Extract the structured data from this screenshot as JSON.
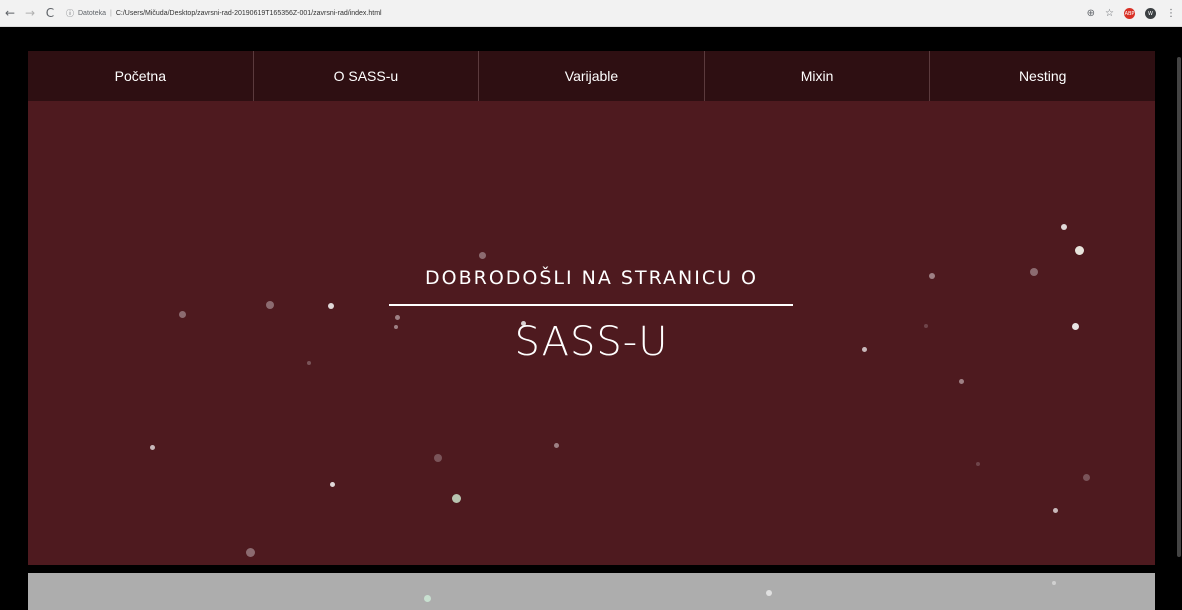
{
  "browser": {
    "back_icon": "←",
    "forward_icon": "→",
    "reload_icon": "C",
    "info_icon": "ⓘ",
    "scheme_label": "Datoteka",
    "url": "C:/Users/Mičuda/Desktop/zavrsni-rad-20190619T165356Z-001/zavrsni-rad/index.html",
    "zoom_icon": "⊕",
    "star_icon": "☆",
    "menu_icon": "⋮",
    "ext_red_label": "ABP",
    "ext_dark_label": "W"
  },
  "nav": {
    "items": [
      {
        "label": "Početna"
      },
      {
        "label": "O SASS-u"
      },
      {
        "label": "Varijable"
      },
      {
        "label": "Mixin"
      },
      {
        "label": "Nesting"
      }
    ]
  },
  "hero": {
    "subtitle": "DOBRODOŠLI NA STRANICU O",
    "title": "SASS-U"
  },
  "colors": {
    "nav_bg": "#2e0f12",
    "hero_bg": "#4e1a1f",
    "section_bg": "#adadad"
  }
}
